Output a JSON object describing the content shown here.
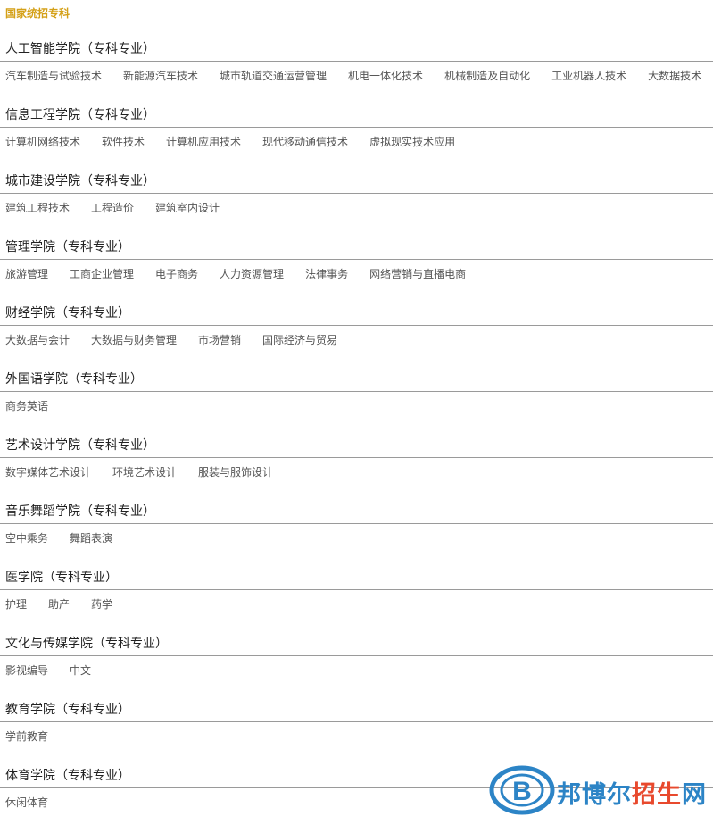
{
  "top_label": "国家统招专科",
  "sections": [
    {
      "title": "人工智能学院（专科专业）",
      "majors": [
        "汽车制造与试验技术",
        "新能源汽车技术",
        "城市轨道交通运营管理",
        "机电一体化技术",
        "机械制造及自动化",
        "工业机器人技术",
        "大数据技术"
      ]
    },
    {
      "title": "信息工程学院（专科专业）",
      "majors": [
        "计算机网络技术",
        "软件技术",
        "计算机应用技术",
        "现代移动通信技术",
        "虚拟现实技术应用"
      ]
    },
    {
      "title": "城市建设学院（专科专业）",
      "majors": [
        "建筑工程技术",
        "工程造价",
        "建筑室内设计"
      ]
    },
    {
      "title": "管理学院（专科专业）",
      "majors": [
        "旅游管理",
        "工商企业管理",
        "电子商务",
        "人力资源管理",
        "法律事务",
        "网络营销与直播电商"
      ]
    },
    {
      "title": "财经学院（专科专业）",
      "majors": [
        "大数据与会计",
        "大数据与财务管理",
        "市场营销",
        "国际经济与贸易"
      ]
    },
    {
      "title": "外国语学院（专科专业）",
      "majors": [
        "商务英语"
      ]
    },
    {
      "title": "艺术设计学院（专科专业）",
      "majors": [
        "数字媒体艺术设计",
        "环境艺术设计",
        "服装与服饰设计"
      ]
    },
    {
      "title": "音乐舞蹈学院（专科专业）",
      "majors": [
        "空中乘务",
        "舞蹈表演"
      ]
    },
    {
      "title": "医学院（专科专业）",
      "majors": [
        "护理",
        "助产",
        "药学"
      ]
    },
    {
      "title": "文化与传媒学院（专科专业）",
      "majors": [
        "影视编导",
        "中文"
      ]
    },
    {
      "title": "教育学院（专科专业）",
      "majors": [
        "学前教育"
      ]
    },
    {
      "title": "体育学院（专科专业）",
      "majors": [
        "休闲体育"
      ]
    }
  ],
  "watermark": {
    "text_main": "邦博尔",
    "text_accent": "招生",
    "text_tail": "网",
    "logo_letter": "B",
    "colors": {
      "blue": "#2c84c6",
      "red": "#e8492d",
      "gold": "#d4a017"
    }
  }
}
